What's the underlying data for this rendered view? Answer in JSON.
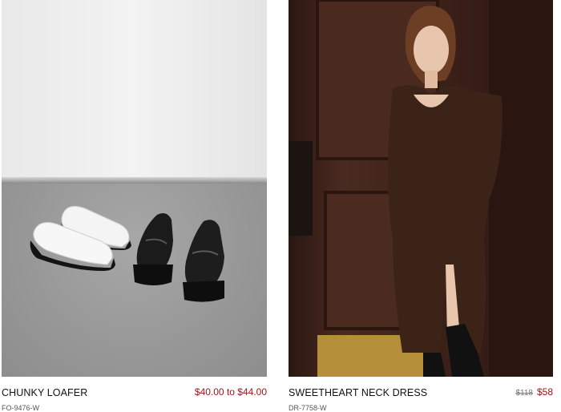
{
  "products": [
    {
      "name": "CHUNKY LOAFER",
      "sku": "FO-9476-W",
      "price": "$40.00 to $44.00",
      "image_alt": "shoes"
    },
    {
      "name": "SWEETHEART NECK DRESS",
      "sku": "DR-7758-W",
      "old_price": "$118",
      "price": "$58",
      "image_alt": "dress"
    }
  ],
  "colors": {
    "price": "#a0131b",
    "text": "#111111",
    "muted": "#555555"
  }
}
